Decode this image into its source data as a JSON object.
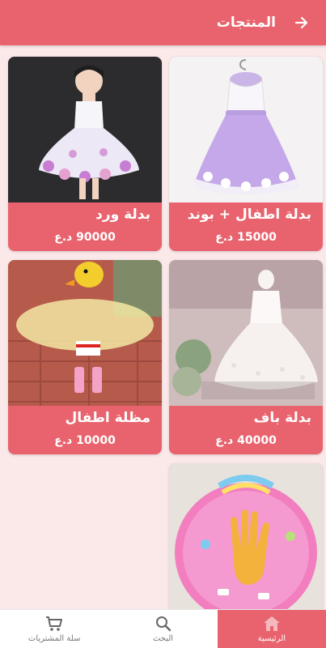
{
  "header": {
    "title": "المنتجات",
    "back_icon": "arrow-right-icon"
  },
  "products": [
    {
      "name": "بدلة اطفال + بوند",
      "price": "15000 د.ع"
    },
    {
      "name": "بدلة ورد",
      "price": "90000 د.ع"
    },
    {
      "name": "بدلة باف",
      "price": "40000 د.ع"
    },
    {
      "name": "مظلة اطفال",
      "price": "10000 د.ع"
    },
    {
      "name": "",
      "price": ""
    }
  ],
  "nav": {
    "home_label": "الرئيسية",
    "search_label": "البحث",
    "cart_label": "سلة المشتريات"
  },
  "colors": {
    "accent": "#e8636d",
    "background": "#fbe9ea"
  }
}
